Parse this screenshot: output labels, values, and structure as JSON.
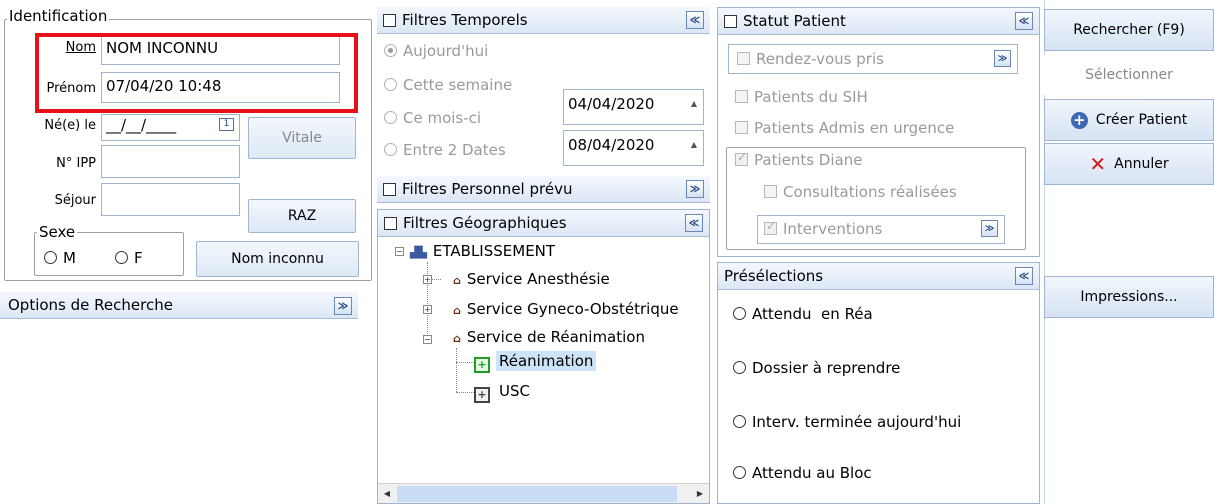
{
  "identification": {
    "legend": "Identification",
    "nom_label": "Nom",
    "nom_value": "NOM INCONNU",
    "prenom_label": "Prénom",
    "prenom_value": "07/04/20 10:48",
    "ne_le_label": "Né(e) le",
    "ne_le_value": "__/__/____",
    "calendar_icon": "1",
    "vitale_button": "Vitale",
    "ipp_label": "N° IPP",
    "sejour_label": "Séjour",
    "raz_button": "RAZ",
    "sexe_legend": "Sexe",
    "sexe_m": "M",
    "sexe_f": "F",
    "nom_inconnu_button": "Nom inconnu"
  },
  "options_recherche": {
    "title": "Options de Recherche"
  },
  "filtres_temporels": {
    "title": "Filtres Temporels",
    "options": [
      "Aujourd'hui",
      "Cette semaine",
      "Ce mois-ci",
      "Entre 2 Dates"
    ],
    "date_from": "04/04/2020",
    "date_to": "08/04/2020"
  },
  "filtres_personnel": {
    "title": "Filtres Personnel prévu"
  },
  "filtres_geo": {
    "title": "Filtres Géographiques",
    "root": "ETABLISSEMENT",
    "services": [
      "Service Anesthésie",
      "Service Gyneco-Obstétrique",
      "Service de Réanimation"
    ],
    "units": [
      "Réanimation",
      "USC"
    ]
  },
  "statut_patient": {
    "title": "Statut Patient",
    "combo_value": "Rendez-vous pris",
    "items": [
      "Patients du SIH",
      "Patients Admis en urgence",
      "Patients Diane"
    ],
    "consultations": "Consultations réalisées",
    "interventions": "Interventions"
  },
  "preselections": {
    "title": "Présélections",
    "items": [
      "Attendu  en Réa",
      "Dossier à reprendre",
      "Interv. terminée aujourd'hui",
      "Attendu au Bloc"
    ]
  },
  "actions": {
    "rechercher": "Rechercher (F9)",
    "selectionner": "Sélectionner",
    "creer_patient": "Créer Patient",
    "annuler": "Annuler",
    "impressions": "Impressions..."
  },
  "colors": {
    "highlight_frame": "#e8101a",
    "selection": "#cde3f7",
    "panel_header": "#dce7f5"
  },
  "icons": [
    "calendar-icon",
    "collapse-icon",
    "expand-icon",
    "building-icon",
    "unit-icon",
    "plus-circle-icon",
    "red-x-icon",
    "dropdown-icon"
  ]
}
